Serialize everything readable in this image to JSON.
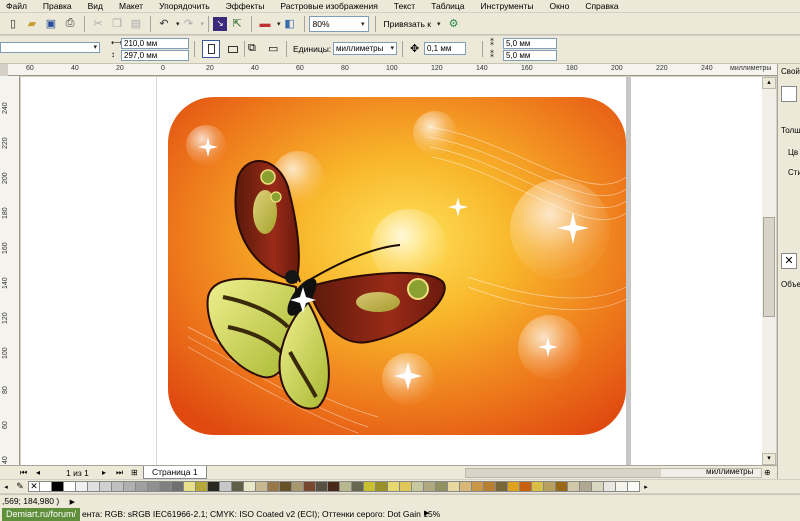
{
  "menu": [
    "Файл",
    "Правка",
    "Вид",
    "Макет",
    "Упорядочить",
    "Эффекты",
    "Растровые изображения",
    "Текст",
    "Таблица",
    "Инструменты",
    "Окно",
    "Справка"
  ],
  "toolbar": {
    "zoom_value": "80%",
    "snap_label": "Привязать к"
  },
  "property_bar": {
    "width": "210,0 мм",
    "height": "297,0 мм",
    "units_label": "Единицы:",
    "units_value": "миллиметры",
    "nudge": "0,1 мм",
    "dup_x": "5,0 мм",
    "dup_y": "5,0 мм"
  },
  "ruler": {
    "h_labels": [
      "60",
      "40",
      "20",
      "0",
      "20",
      "40",
      "60",
      "80",
      "100",
      "120",
      "140",
      "160",
      "180",
      "200",
      "220",
      "240"
    ],
    "h_unit": "миллиметры",
    "v_labels": [
      "240",
      "220",
      "200",
      "180",
      "160",
      "140",
      "120",
      "100",
      "80",
      "60",
      "40"
    ]
  },
  "docker": {
    "title": "Свой",
    "line1": "Толщ",
    "line2": "Цв",
    "line3": "Сти",
    "objects": "Объе"
  },
  "pagenav": {
    "counter": "1 из 1",
    "tab": "Страница 1",
    "unit": "миллиметры"
  },
  "palette_colors": [
    "#ffffff",
    "#000000",
    "#ffffff",
    "#f0f0f0",
    "#e0e0e0",
    "#d0d0d0",
    "#c0c0c0",
    "#b0b0b0",
    "#a0a0a0",
    "#909090",
    "#808080",
    "#707070",
    "#e8e08a",
    "#b8a83a",
    "#282820",
    "#c8c8c8",
    "#606048",
    "#e8e8c8",
    "#c8b890",
    "#987848",
    "#685028",
    "#a89870",
    "#784830",
    "#585040",
    "#482818",
    "#b8b890",
    "#686850",
    "#c8c030",
    "#989028",
    "#e8d870",
    "#e0c858",
    "#c8c8a0",
    "#b0a880",
    "#909060",
    "#e8d8a0",
    "#d8b878",
    "#c89848",
    "#b88030",
    "#786838",
    "#e0a020",
    "#c86010",
    "#d8c048",
    "#b8a060",
    "#986818",
    "#d0c8a8",
    "#b0a890",
    "#d8d8c0",
    "#e8e8e0",
    "#f4f4ec",
    "#fcfcf8"
  ],
  "status": {
    "coords": ",569; 184,980 )",
    "profile": "ента: RGB: sRGB IEC61966-2.1; CMYK: ISO Coated v2 (ECI); Оттенки серого: Dot Gain 15%",
    "watermark": "Demiart.ru/forum/"
  }
}
